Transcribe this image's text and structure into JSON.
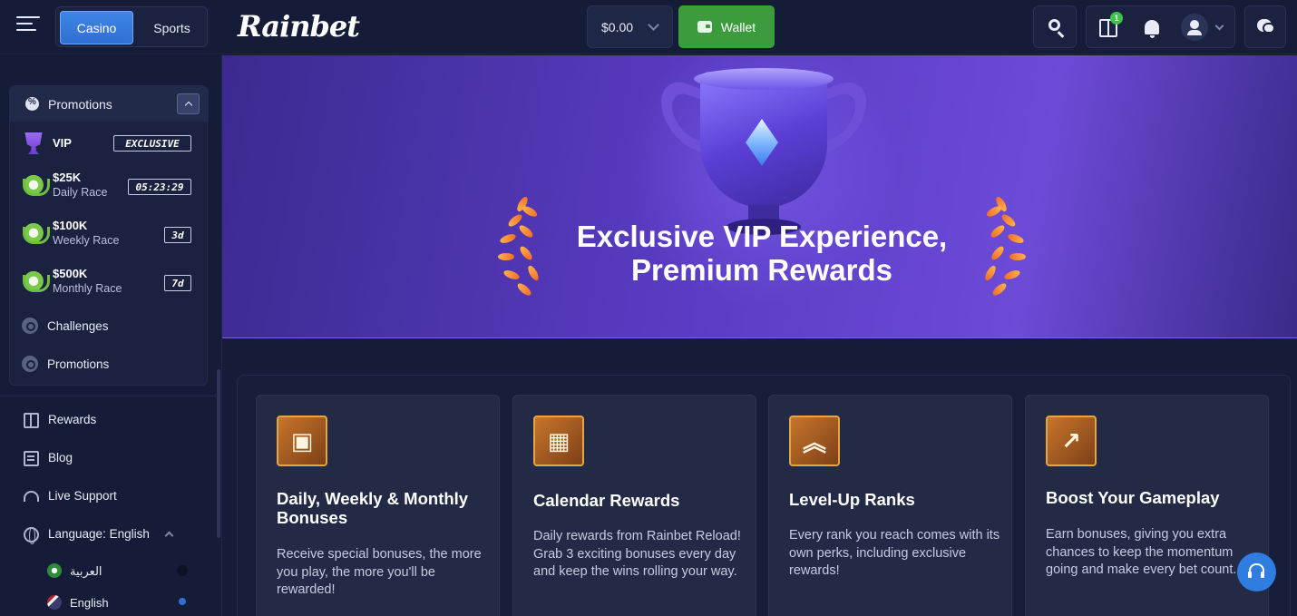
{
  "header": {
    "tabs": [
      "Casino",
      "Sports"
    ],
    "logo": "Rainbet",
    "balance": "$0.00",
    "wallet_label": "Wallet",
    "gift_badge": "1"
  },
  "sidebar": {
    "promotions_header": "Promotions",
    "vip": {
      "label": "VIP",
      "tag": "EXCLUSIVE"
    },
    "races": [
      {
        "amount": "$25K",
        "name": "Daily Race",
        "tag": "05:23:29"
      },
      {
        "amount": "$100K",
        "name": "Weekly Race",
        "tag": "3d"
      },
      {
        "amount": "$500K",
        "name": "Monthly Race",
        "tag": "7d"
      }
    ],
    "challenges": "Challenges",
    "promotions": "Promotions",
    "nav": [
      "Rewards",
      "Blog",
      "Live Support",
      "Language: English"
    ],
    "languages": [
      "العربية",
      "English"
    ]
  },
  "hero": {
    "title_line1": "Exclusive VIP Experience,",
    "title_line2": "Premium Rewards"
  },
  "cards": [
    {
      "title": "Daily, Weekly & Monthly Bonuses",
      "desc": "Receive special bonuses, the more you play, the more you'll be rewarded!",
      "icon": "gift-icon"
    },
    {
      "title": "Calendar Rewards",
      "desc": "Daily rewards from Rainbet Reload! Grab 3 exciting bonuses every day and keep the wins rolling your way.",
      "icon": "calendar-icon"
    },
    {
      "title": "Level-Up Ranks",
      "desc": "Every rank you reach comes with its own perks, including exclusive rewards!",
      "icon": "chevrons-up-icon"
    },
    {
      "title": "Boost Your Gameplay",
      "desc": "Earn bonuses, giving you extra chances to keep the momentum going and make every bet count.",
      "icon": "chart-up-icon"
    }
  ],
  "colors": {
    "accent_blue": "#2f6fd0",
    "wallet_green": "#3c9b3d",
    "hero_purple": "#5a3cc4",
    "icon_orange": "#e6a545"
  }
}
